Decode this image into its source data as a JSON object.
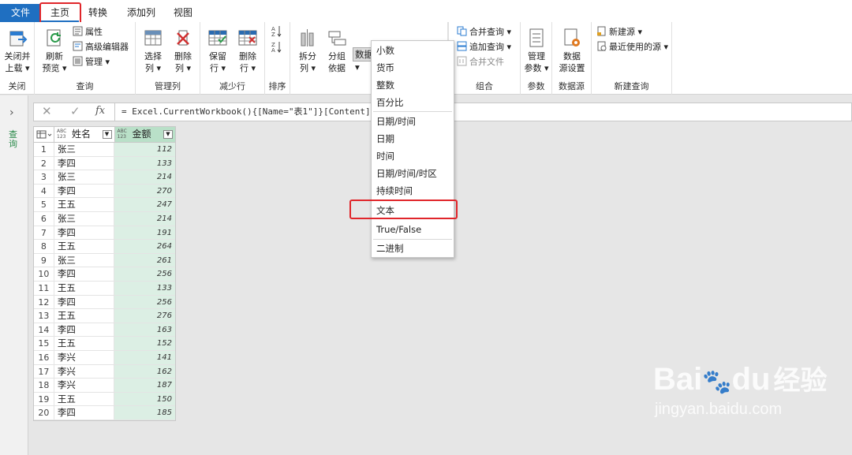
{
  "tabs": {
    "file": "文件",
    "home": "主页",
    "transform": "转换",
    "add_column": "添加列",
    "view": "视图"
  },
  "ribbon": {
    "close": {
      "btn_line1": "关闭并",
      "btn_line2": "上载 ▾",
      "group": "关闭"
    },
    "query": {
      "refresh_line1": "刷新",
      "refresh_line2": "预览 ▾",
      "properties": "属性",
      "advanced_editor": "高级编辑器",
      "manage": "管理 ▾",
      "group": "查询"
    },
    "manage_columns": {
      "choose_line1": "选择",
      "choose_line2": "列 ▾",
      "remove_line1": "删除",
      "remove_line2": "列 ▾",
      "group": "管理列"
    },
    "reduce_rows": {
      "keep_line1": "保留",
      "keep_line2": "行 ▾",
      "remove_line1": "删除",
      "remove_line2": "行 ▾",
      "group": "减少行"
    },
    "sort": {
      "group": "排序"
    },
    "transform": {
      "split_line1": "拆分",
      "split_line2": "列 ▾",
      "group_line1": "分组",
      "group_line2": "依据",
      "data_type": "数据类型: 任意 ▾"
    },
    "combine": {
      "merge": "合并查询 ▾",
      "append": "追加查询 ▾",
      "combine_files": "合并文件",
      "group": "组合"
    },
    "params": {
      "btn_line1": "管理",
      "btn_line2": "参数 ▾",
      "group": "参数"
    },
    "datasource": {
      "btn_line1": "数据",
      "btn_line2": "源设置",
      "group": "数据源"
    },
    "new_query": {
      "new_source": "新建源 ▾",
      "recent": "最近使用的源 ▾",
      "group": "新建查询"
    }
  },
  "left_pane": {
    "label": "查询"
  },
  "formula": "= Excel.CurrentWorkbook(){[Name=\"表1\"]}[Content]",
  "table": {
    "col1_type": "ABC\n123",
    "col1": "姓名",
    "col2_type": "ABC\n123",
    "col2": "金额",
    "rows": [
      [
        "1",
        "张三",
        "112"
      ],
      [
        "2",
        "李四",
        "133"
      ],
      [
        "3",
        "张三",
        "214"
      ],
      [
        "4",
        "李四",
        "270"
      ],
      [
        "5",
        "王五",
        "247"
      ],
      [
        "6",
        "张三",
        "214"
      ],
      [
        "7",
        "李四",
        "191"
      ],
      [
        "8",
        "王五",
        "264"
      ],
      [
        "9",
        "张三",
        "261"
      ],
      [
        "10",
        "李四",
        "256"
      ],
      [
        "11",
        "王五",
        "133"
      ],
      [
        "12",
        "李四",
        "256"
      ],
      [
        "13",
        "王五",
        "276"
      ],
      [
        "14",
        "李四",
        "163"
      ],
      [
        "15",
        "王五",
        "152"
      ],
      [
        "16",
        "李兴",
        "141"
      ],
      [
        "17",
        "李兴",
        "162"
      ],
      [
        "18",
        "李兴",
        "187"
      ],
      [
        "19",
        "王五",
        "150"
      ],
      [
        "20",
        "李四",
        "185"
      ]
    ]
  },
  "menu": [
    "小数",
    "货币",
    "整数",
    "百分比",
    "日期/时间",
    "日期",
    "时间",
    "日期/时间/时区",
    "持续时间",
    "文本",
    "True/False",
    "二进制"
  ],
  "watermark": {
    "brand": "Bai",
    "brand2": "du",
    "paw": "🐾",
    "cn": "经验",
    "url": "jingyan.baidu.com"
  }
}
